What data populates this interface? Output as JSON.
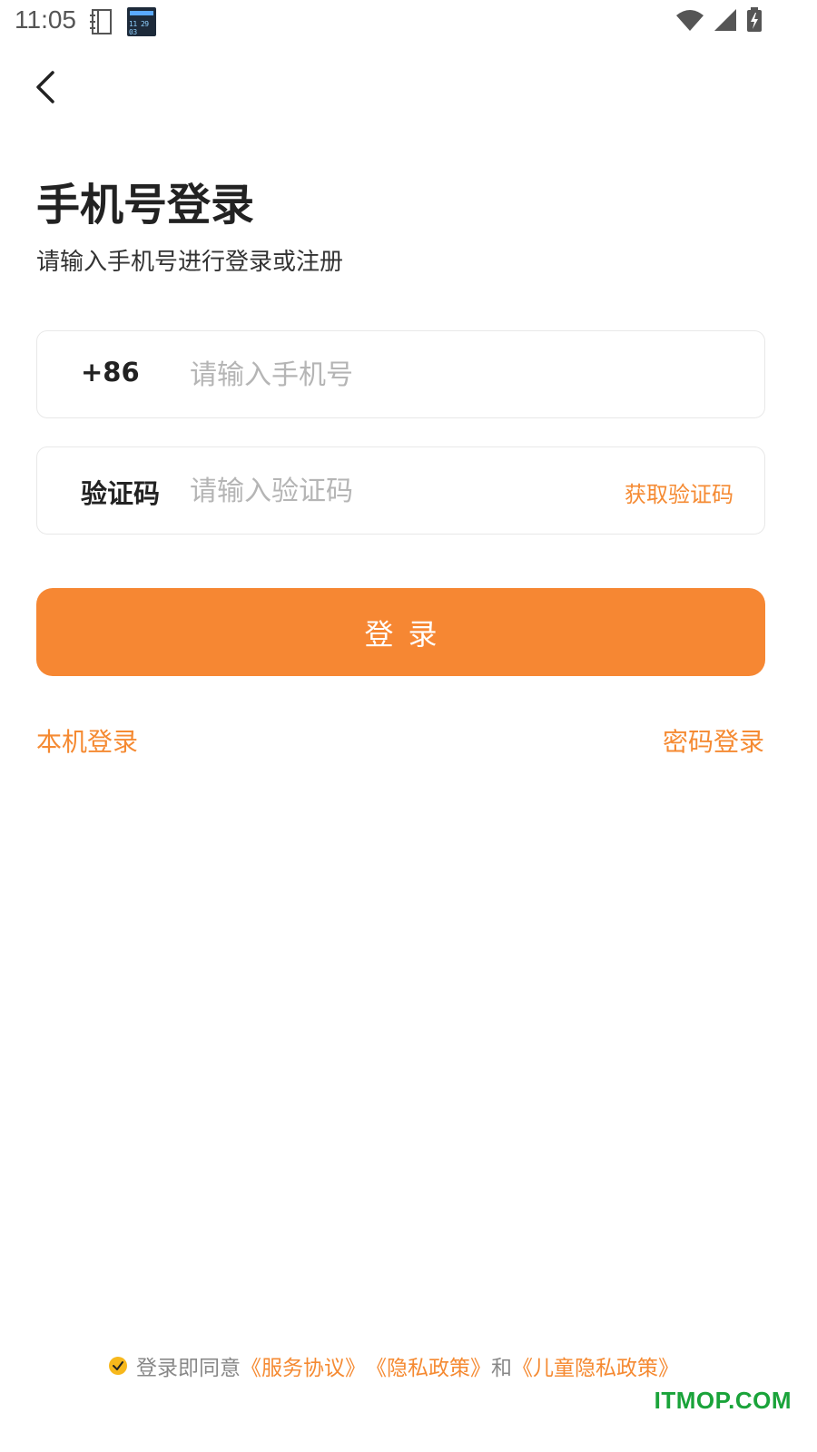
{
  "status_bar": {
    "time": "11:05",
    "app_icon_digits": "11 29 03",
    "icons": [
      "notebook-icon",
      "clock-app-icon",
      "wifi-icon",
      "signal-icon",
      "battery-charging-icon"
    ]
  },
  "nav": {
    "back_icon": "chevron-left-icon"
  },
  "header": {
    "title": "手机号登录",
    "subtitle": "请输入手机号进行登录或注册"
  },
  "phone_field": {
    "prefix": "+86",
    "placeholder": "请输入手机号",
    "value": ""
  },
  "code_field": {
    "label": "验证码",
    "placeholder": "请输入验证码",
    "value": "",
    "get_code_label": "获取验证码"
  },
  "login_button": {
    "label": "登录"
  },
  "links": {
    "local_login": "本机登录",
    "password_login": "密码登录"
  },
  "agreement": {
    "checked": true,
    "prefix": "登录即同意",
    "service": "《服务协议》",
    "privacy": "《隐私政策》",
    "and": "和",
    "children_privacy": "《儿童隐私政策》"
  },
  "watermark": "ITMOP.COM",
  "colors": {
    "accent": "#f68733",
    "link": "#f58a32",
    "check": "#f7b81c",
    "watermark": "#1aa33a"
  }
}
